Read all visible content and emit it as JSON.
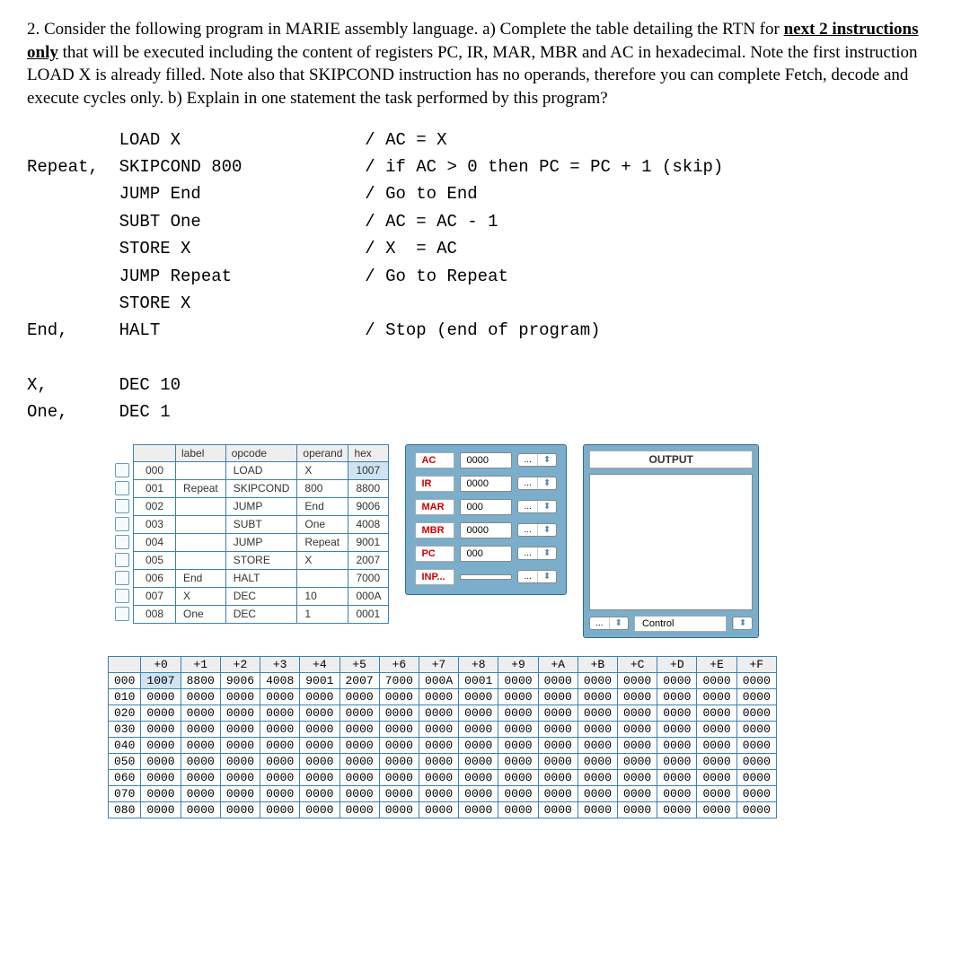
{
  "question": {
    "number": "2.",
    "prefix": "Consider the following program in MARIE assembly language. a) Complete the table detailing the RTN for ",
    "underlined": "next 2 instructions only",
    "suffix": " that will be executed including the content of registers PC, IR, MAR, MBR and AC in hexadecimal. Note the first instruction LOAD X is already filled. Note also that SKIPCOND instruction has no operands, therefore you can complete Fetch, decode and execute cycles only. b) Explain in one statement the task performed by this program?"
  },
  "code": {
    "lines": [
      {
        "label": "",
        "instr": "LOAD X",
        "comment": "/ AC = X"
      },
      {
        "label": "Repeat,",
        "instr": "SKIPCOND 800",
        "comment": "/ if AC > 0 then PC = PC + 1 (skip)"
      },
      {
        "label": "",
        "instr": "JUMP End",
        "comment": "/ Go to End"
      },
      {
        "label": "",
        "instr": "SUBT One",
        "comment": "/ AC = AC - 1"
      },
      {
        "label": "",
        "instr": "STORE X",
        "comment": "/ X  = AC"
      },
      {
        "label": "",
        "instr": "JUMP Repeat",
        "comment": "/ Go to Repeat"
      },
      {
        "label": "",
        "instr": "STORE X",
        "comment": ""
      },
      {
        "label": "End,",
        "instr": "HALT",
        "comment": "/ Stop (end of program)"
      },
      {
        "label": "",
        "instr": "",
        "comment": ""
      },
      {
        "label": "X,",
        "instr": "DEC 10",
        "comment": ""
      },
      {
        "label": "One,",
        "instr": "DEC 1",
        "comment": ""
      }
    ]
  },
  "listing": {
    "headers": {
      "label": "label",
      "opcode": "opcode",
      "operand": "operand",
      "hex": "hex"
    },
    "rows": [
      {
        "addr": "000",
        "label": "",
        "opcode": "LOAD",
        "operand": "X",
        "hex": "1007",
        "selected": true
      },
      {
        "addr": "001",
        "label": "Repeat",
        "opcode": "SKIPCOND",
        "operand": "800",
        "hex": "8800",
        "selected": false
      },
      {
        "addr": "002",
        "label": "",
        "opcode": "JUMP",
        "operand": "End",
        "hex": "9006",
        "selected": false
      },
      {
        "addr": "003",
        "label": "",
        "opcode": "SUBT",
        "operand": "One",
        "hex": "4008",
        "selected": false
      },
      {
        "addr": "004",
        "label": "",
        "opcode": "JUMP",
        "operand": "Repeat",
        "hex": "9001",
        "selected": false
      },
      {
        "addr": "005",
        "label": "",
        "opcode": "STORE",
        "operand": "X",
        "hex": "2007",
        "selected": false
      },
      {
        "addr": "006",
        "label": "End",
        "opcode": "HALT",
        "operand": "",
        "hex": "7000",
        "selected": false
      },
      {
        "addr": "007",
        "label": "X",
        "opcode": "DEC",
        "operand": "10",
        "hex": "000A",
        "selected": false
      },
      {
        "addr": "008",
        "label": "One",
        "opcode": "DEC",
        "operand": "1",
        "hex": "0001",
        "selected": false
      }
    ]
  },
  "registers": {
    "AC": "0000",
    "IR": "0000",
    "MAR": "000",
    "MBR": "0000",
    "PC": "000",
    "INP": ""
  },
  "labels": {
    "AC": "AC",
    "IR": "IR",
    "MAR": "MAR",
    "MBR": "MBR",
    "PC": "PC",
    "INP": "INP...",
    "stepper": "...",
    "arrows": "⬍"
  },
  "outputPanel": {
    "header": "OUTPUT",
    "control": "Control"
  },
  "memdump": {
    "headers": [
      "",
      "+0",
      "+1",
      "+2",
      "+3",
      "+4",
      "+5",
      "+6",
      "+7",
      "+8",
      "+9",
      "+A",
      "+B",
      "+C",
      "+D",
      "+E",
      "+F"
    ],
    "rows": [
      {
        "addr": "000",
        "cells": [
          "1007",
          "8800",
          "9006",
          "4008",
          "9001",
          "2007",
          "7000",
          "000A",
          "0001",
          "0000",
          "0000",
          "0000",
          "0000",
          "0000",
          "0000",
          "0000"
        ],
        "hi": 0
      },
      {
        "addr": "010",
        "cells": [
          "0000",
          "0000",
          "0000",
          "0000",
          "0000",
          "0000",
          "0000",
          "0000",
          "0000",
          "0000",
          "0000",
          "0000",
          "0000",
          "0000",
          "0000",
          "0000"
        ],
        "hi": -1
      },
      {
        "addr": "020",
        "cells": [
          "0000",
          "0000",
          "0000",
          "0000",
          "0000",
          "0000",
          "0000",
          "0000",
          "0000",
          "0000",
          "0000",
          "0000",
          "0000",
          "0000",
          "0000",
          "0000"
        ],
        "hi": -1
      },
      {
        "addr": "030",
        "cells": [
          "0000",
          "0000",
          "0000",
          "0000",
          "0000",
          "0000",
          "0000",
          "0000",
          "0000",
          "0000",
          "0000",
          "0000",
          "0000",
          "0000",
          "0000",
          "0000"
        ],
        "hi": -1
      },
      {
        "addr": "040",
        "cells": [
          "0000",
          "0000",
          "0000",
          "0000",
          "0000",
          "0000",
          "0000",
          "0000",
          "0000",
          "0000",
          "0000",
          "0000",
          "0000",
          "0000",
          "0000",
          "0000"
        ],
        "hi": -1
      },
      {
        "addr": "050",
        "cells": [
          "0000",
          "0000",
          "0000",
          "0000",
          "0000",
          "0000",
          "0000",
          "0000",
          "0000",
          "0000",
          "0000",
          "0000",
          "0000",
          "0000",
          "0000",
          "0000"
        ],
        "hi": -1
      },
      {
        "addr": "060",
        "cells": [
          "0000",
          "0000",
          "0000",
          "0000",
          "0000",
          "0000",
          "0000",
          "0000",
          "0000",
          "0000",
          "0000",
          "0000",
          "0000",
          "0000",
          "0000",
          "0000"
        ],
        "hi": -1
      },
      {
        "addr": "070",
        "cells": [
          "0000",
          "0000",
          "0000",
          "0000",
          "0000",
          "0000",
          "0000",
          "0000",
          "0000",
          "0000",
          "0000",
          "0000",
          "0000",
          "0000",
          "0000",
          "0000"
        ],
        "hi": -1
      },
      {
        "addr": "080",
        "cells": [
          "0000",
          "0000",
          "0000",
          "0000",
          "0000",
          "0000",
          "0000",
          "0000",
          "0000",
          "0000",
          "0000",
          "0000",
          "0000",
          "0000",
          "0000",
          "0000"
        ],
        "hi": -1
      }
    ]
  }
}
